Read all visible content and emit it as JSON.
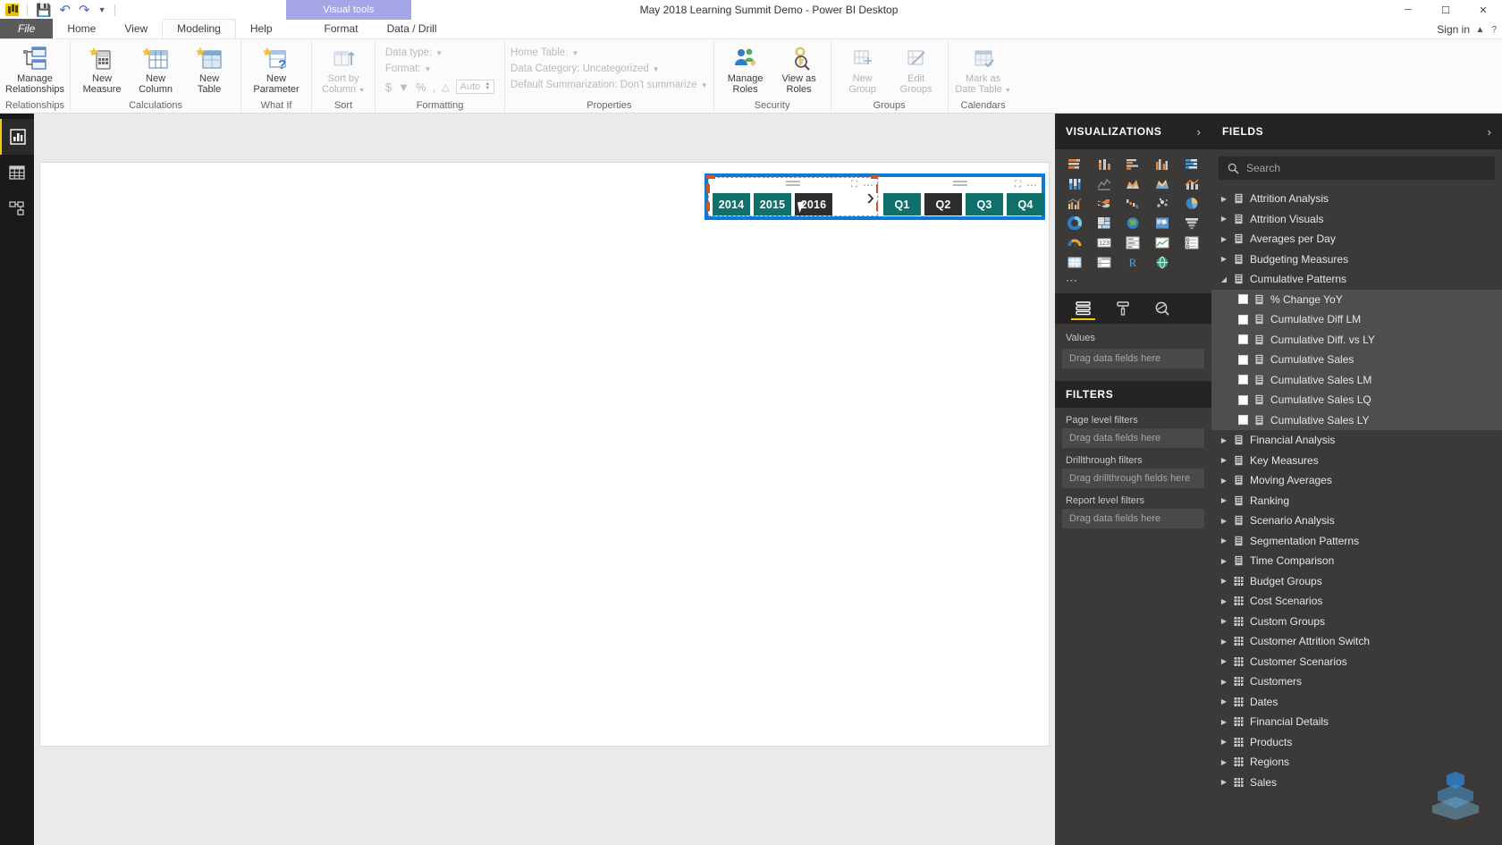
{
  "window": {
    "title": "May 2018 Learning Summit Demo - Power BI Desktop",
    "visual_tools_label": "Visual tools",
    "minimize": "─",
    "maximize": "☐",
    "close": "✕",
    "sign_in": "Sign in",
    "ribbon_collapse": "▲",
    "help": "?"
  },
  "quick_access": {
    "save_icon": "save-icon",
    "undo_icon": "undo-icon",
    "redo_icon": "redo-icon",
    "customize_icon": "customize-icon"
  },
  "ribbon_tabs": [
    {
      "label": "File",
      "kind": "file"
    },
    {
      "label": "Home",
      "kind": "normal"
    },
    {
      "label": "View",
      "kind": "normal"
    },
    {
      "label": "Modeling",
      "kind": "active"
    },
    {
      "label": "Help",
      "kind": "normal"
    },
    {
      "label": "Format",
      "kind": "sub"
    },
    {
      "label": "Data / Drill",
      "kind": "sub"
    }
  ],
  "ribbon": {
    "groups": [
      {
        "label": "Relationships",
        "buttons": [
          {
            "caption": "Manage\nRelationships",
            "icon": "manage-relationships-icon",
            "dim": false
          }
        ]
      },
      {
        "label": "Calculations",
        "buttons": [
          {
            "caption": "New\nMeasure",
            "icon": "new-measure-icon",
            "dim": false
          },
          {
            "caption": "New\nColumn",
            "icon": "new-column-icon",
            "dim": false
          },
          {
            "caption": "New\nTable",
            "icon": "new-table-icon",
            "dim": false
          }
        ]
      },
      {
        "label": "What If",
        "buttons": [
          {
            "caption": "New\nParameter",
            "icon": "new-parameter-icon",
            "dim": false
          }
        ]
      },
      {
        "label": "Sort",
        "buttons": [
          {
            "caption": "Sort by\nColumn",
            "icon": "sort-by-column-icon",
            "dim": true
          }
        ]
      },
      {
        "label": "Security",
        "buttons": [
          {
            "caption": "Manage\nRoles",
            "icon": "manage-roles-icon",
            "dim": false
          },
          {
            "caption": "View as\nRoles",
            "icon": "view-as-roles-icon",
            "dim": false
          }
        ]
      },
      {
        "label": "Groups",
        "buttons": [
          {
            "caption": "New\nGroup",
            "icon": "new-group-icon",
            "dim": true
          },
          {
            "caption": "Edit\nGroups",
            "icon": "edit-groups-icon",
            "dim": true
          }
        ]
      },
      {
        "label": "Calendars",
        "buttons": [
          {
            "caption": "Mark as\nDate Table",
            "icon": "mark-as-date-table-icon",
            "dim": true
          }
        ]
      }
    ],
    "formatting": {
      "label": "Formatting",
      "data_type": "Data type:",
      "format": "Format:",
      "currency_icon": "$",
      "percent_icon": "%",
      "comma_icon": ",",
      "decimal_icon": "decimal-places-icon",
      "auto_value": "Auto"
    },
    "properties": {
      "label": "Properties",
      "home_table": "Home Table:",
      "data_category": "Data Category: Uncategorized",
      "default_summarization": "Default Summarization: Don't summarize"
    }
  },
  "left_nav": [
    {
      "name": "report-view",
      "icon": "report-view-icon",
      "active": true
    },
    {
      "name": "data-view",
      "icon": "data-view-icon",
      "active": false
    },
    {
      "name": "model-view",
      "icon": "model-view-icon",
      "active": false
    }
  ],
  "canvas": {
    "year_slicer": {
      "name": "year-slicer",
      "chips": [
        {
          "label": "2014",
          "selected": true
        },
        {
          "label": "2015",
          "selected": true
        },
        {
          "label": "2016",
          "selected": false
        }
      ],
      "expand_chevron": "›",
      "focus_icon": "focus-mode-icon",
      "more_icon": "more-options-icon"
    },
    "quarter_slicer": {
      "name": "quarter-slicer",
      "chips": [
        {
          "label": "Q1",
          "selected": true
        },
        {
          "label": "Q2",
          "selected": false
        },
        {
          "label": "Q3",
          "selected": true
        },
        {
          "label": "Q4",
          "selected": true
        }
      ],
      "focus_icon": "focus-mode-icon",
      "more_icon": "more-options-icon"
    },
    "selection_color": "#0c7ad5",
    "chip_on_color": "#10706c",
    "chip_off_color": "#2d2d2d"
  },
  "visualizations": {
    "title": "VISUALIZATIONS",
    "collapse": "›",
    "icons": [
      "stacked-bar-chart-icon",
      "stacked-column-chart-icon",
      "clustered-bar-chart-icon",
      "clustered-column-chart-icon",
      "100-stacked-bar-chart-icon",
      "100-stacked-column-chart-icon",
      "line-chart-icon",
      "area-chart-icon",
      "stacked-area-chart-icon",
      "line-stacked-column-icon",
      "line-clustered-column-icon",
      "ribbon-chart-icon",
      "waterfall-chart-icon",
      "scatter-chart-icon",
      "pie-chart-icon",
      "donut-chart-icon",
      "treemap-icon",
      "map-icon",
      "filled-map-icon",
      "funnel-icon",
      "gauge-icon",
      "card-icon",
      "multi-row-card-icon",
      "kpi-icon",
      "slicer-icon",
      "table-icon",
      "matrix-icon",
      "r-script-icon",
      "python-visual-icon"
    ],
    "more_icon": "more-visuals-icon",
    "tabs": [
      {
        "name": "fields-tab",
        "icon": "fields-well-icon",
        "active": true
      },
      {
        "name": "format-tab",
        "icon": "paint-roller-icon",
        "active": false
      },
      {
        "name": "analytics-tab",
        "icon": "analytics-magnifier-icon",
        "active": false
      }
    ],
    "wells": [
      {
        "label": "Values",
        "placeholder": "Drag data fields here"
      }
    ]
  },
  "filters": {
    "title": "FILTERS",
    "sections": [
      {
        "label": "Page level filters",
        "placeholder": "Drag data fields here"
      },
      {
        "label": "Drillthrough filters",
        "placeholder": "Drag drillthrough fields here"
      },
      {
        "label": "Report level filters",
        "placeholder": "Drag data fields here"
      }
    ]
  },
  "fields": {
    "title": "FIELDS",
    "collapse": "›",
    "search_placeholder": "Search",
    "search_icon": "search-icon",
    "items": [
      {
        "label": "Attrition Analysis",
        "type": "table-measures",
        "state": "collapsed",
        "selected": false
      },
      {
        "label": "Attrition Visuals",
        "type": "table-measures",
        "state": "collapsed",
        "selected": false
      },
      {
        "label": "Averages per Day",
        "type": "table-measures",
        "state": "collapsed",
        "selected": false
      },
      {
        "label": "Budgeting Measures",
        "type": "table-measures",
        "state": "collapsed",
        "selected": false
      },
      {
        "label": "Cumulative Patterns",
        "type": "table-measures",
        "state": "expanded",
        "selected": false
      },
      {
        "label": "% Change YoY",
        "type": "measure",
        "state": "child",
        "selected": true
      },
      {
        "label": "Cumulative Diff LM",
        "type": "measure",
        "state": "child",
        "selected": true
      },
      {
        "label": "Cumulative Diff. vs LY",
        "type": "measure",
        "state": "child",
        "selected": true
      },
      {
        "label": "Cumulative Sales",
        "type": "measure",
        "state": "child",
        "selected": true
      },
      {
        "label": "Cumulative Sales LM",
        "type": "measure",
        "state": "child",
        "selected": true
      },
      {
        "label": "Cumulative Sales LQ",
        "type": "measure",
        "state": "child",
        "selected": true
      },
      {
        "label": "Cumulative Sales LY",
        "type": "measure",
        "state": "child",
        "selected": true
      },
      {
        "label": "Financial Analysis",
        "type": "table-measures",
        "state": "collapsed",
        "selected": false
      },
      {
        "label": "Key Measures",
        "type": "table-measures",
        "state": "collapsed",
        "selected": false
      },
      {
        "label": "Moving Averages",
        "type": "table-measures",
        "state": "collapsed",
        "selected": false
      },
      {
        "label": "Ranking",
        "type": "table-measures",
        "state": "collapsed",
        "selected": false
      },
      {
        "label": "Scenario Analysis",
        "type": "table-measures",
        "state": "collapsed",
        "selected": false
      },
      {
        "label": "Segmentation Patterns",
        "type": "table-measures",
        "state": "collapsed",
        "selected": false
      },
      {
        "label": "Time Comparison",
        "type": "table-measures",
        "state": "collapsed",
        "selected": false
      },
      {
        "label": "Budget Groups",
        "type": "table",
        "state": "collapsed",
        "selected": false
      },
      {
        "label": "Cost Scenarios",
        "type": "table",
        "state": "collapsed",
        "selected": false
      },
      {
        "label": "Custom Groups",
        "type": "table",
        "state": "collapsed",
        "selected": false
      },
      {
        "label": "Customer Attrition Switch",
        "type": "table",
        "state": "collapsed",
        "selected": false
      },
      {
        "label": "Customer Scenarios",
        "type": "table",
        "state": "collapsed",
        "selected": false
      },
      {
        "label": "Customers",
        "type": "table",
        "state": "collapsed",
        "selected": false
      },
      {
        "label": "Dates",
        "type": "table",
        "state": "collapsed",
        "selected": false
      },
      {
        "label": "Financial Details",
        "type": "table",
        "state": "collapsed",
        "selected": false
      },
      {
        "label": "Products",
        "type": "table",
        "state": "collapsed",
        "selected": false
      },
      {
        "label": "Regions",
        "type": "table",
        "state": "collapsed",
        "selected": false
      },
      {
        "label": "Sales",
        "type": "table",
        "state": "collapsed",
        "selected": false
      }
    ]
  }
}
